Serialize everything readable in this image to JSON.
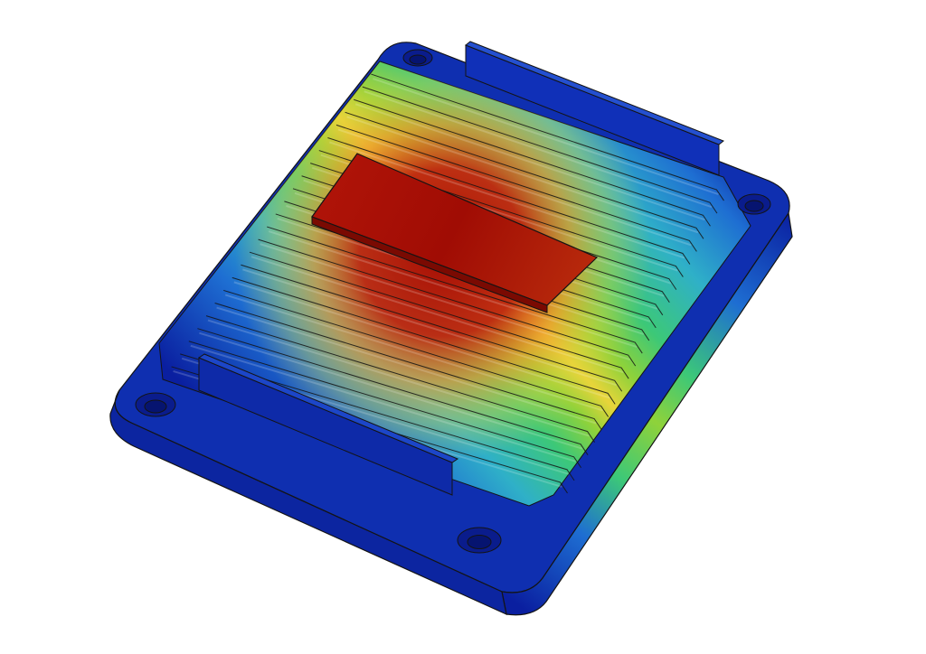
{
  "figure": {
    "subject": "heat-sink-thermal-simulation",
    "background_color": "#ffffff",
    "fin_count": 25,
    "central_pad": true,
    "mounting_holes": 4,
    "colormap": {
      "name": "jet",
      "stops": [
        "#0a1fa0",
        "#1e6ed2",
        "#2fb0c8",
        "#3cc878",
        "#8fd23a",
        "#e8d43a",
        "#f0962a",
        "#d0401a",
        "#a50d05"
      ]
    },
    "edge_color": "#141414"
  }
}
